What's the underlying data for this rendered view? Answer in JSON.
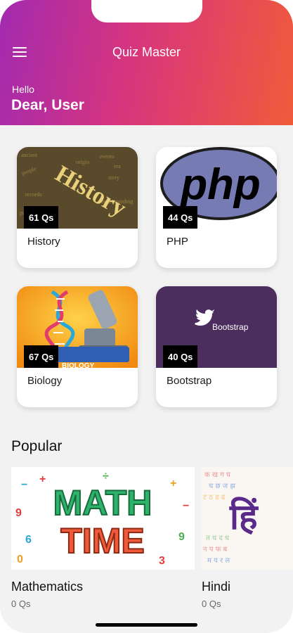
{
  "header": {
    "title": "Quiz Master",
    "greeting": "Hello",
    "user_name": "Dear, User"
  },
  "categories": [
    {
      "label": "History",
      "count": "61 Qs",
      "image_text": "History"
    },
    {
      "label": "PHP",
      "count": "44 Qs",
      "image_text": "php"
    },
    {
      "label": "Biology",
      "count": "67 Qs",
      "image_text": "BIOLOGY"
    },
    {
      "label": "Bootstrap",
      "count": "40 Qs",
      "image_text": "Bootstrap"
    }
  ],
  "popular": {
    "title": "Popular",
    "items": [
      {
        "name": "Mathematics",
        "count": "0 Qs",
        "image_text_1": "MATH",
        "image_text_2": "TIME"
      },
      {
        "name": "Hindi",
        "count": "0 Qs",
        "image_text": "हिं"
      }
    ]
  },
  "colors": {
    "header_gradient_start": "#a22ab0",
    "header_gradient_end": "#f15b3a",
    "php_blue": "#777bb3",
    "bootstrap_purple": "#4b2e5e"
  }
}
